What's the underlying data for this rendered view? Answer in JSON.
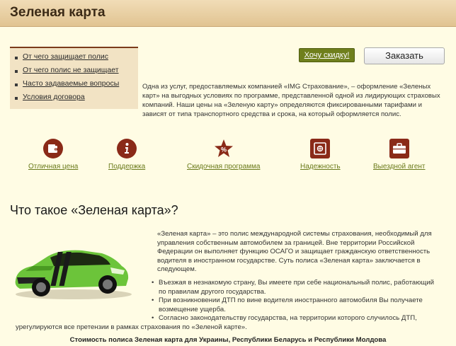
{
  "header": {
    "title": "Зеленая карта"
  },
  "menu": {
    "items": [
      "От чего защищает полис",
      "От чего полис не защищает",
      "Часто задаваемые вопросы",
      "Условия договора"
    ]
  },
  "buttons": {
    "discount": "Хочу скидку!",
    "order": "Заказать"
  },
  "intro": "Одна из услуг, предоставляемых компанией «IMG Страхование», – оформление «Зеленых карт» на выгодных условиях по программе, представленной одной из лидирующих страховых компаний. Наши цены на «Зеленую карту» определяются фиксированными тарифами и зависят от типа транспортного средства и срока, на который оформляется полис.",
  "features": [
    {
      "label": "Отличная цена",
      "icon": "wallet-icon"
    },
    {
      "label": "Поддержка",
      "icon": "info-icon"
    },
    {
      "label": "Скидочная программа",
      "icon": "percent-star-icon"
    },
    {
      "label": "Надежность",
      "icon": "safe-icon"
    },
    {
      "label": "Выездной агент",
      "icon": "briefcase-icon"
    }
  ],
  "section": {
    "title": "Что такое «Зеленая карта»?",
    "description": "«Зеленая карта» – это полис международной системы страхования, необходимый для управления собственным автомобилем за границей. Вне территории Российской Федерации он выполняет функцию ОСАГО и защищает гражданскую ответственность водителя в иностранном государстве. Суть полиса «Зеленая карта» заключается в следующем.",
    "bullets": [
      "Въезжая в незнакомую страну, Вы имеете при себе национальный полис, работающий по правилам другого государства.",
      "При возникновении ДТП по вине водителя иностранного автомобиля Вы получаете возмещение ущерба.",
      "Согласно законодательству государства, на территории которого случилось ДТП,"
    ],
    "tail": "урегулируются все претензии в рамках страхования по «Зеленой карте».",
    "cost_title": "Стоимость полиса Зеленая карта для Украины, Республики Беларусь и Республики Молдова"
  },
  "colors": {
    "accent_dark_red": "#8a2a18",
    "link_green": "#6a7a1a",
    "button_green": "#6f7f1c",
    "car_green": "#6cc43a"
  }
}
